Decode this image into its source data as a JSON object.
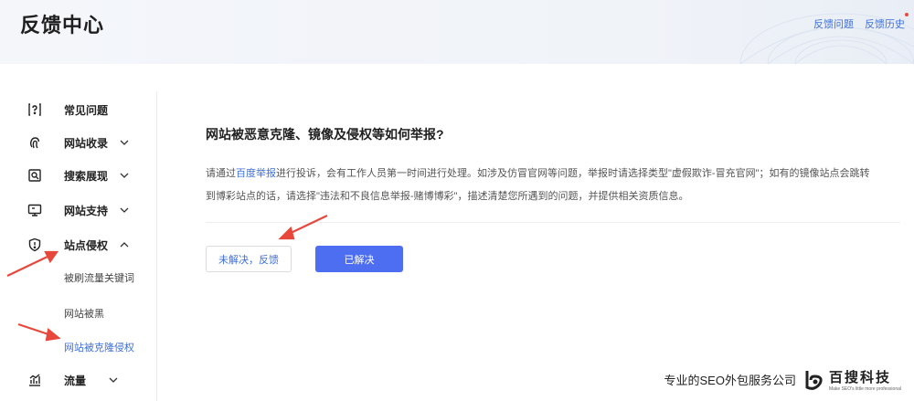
{
  "header": {
    "title": "反馈中心",
    "links": [
      "反馈问题",
      "反馈历史"
    ]
  },
  "sidebar": {
    "items": [
      {
        "label": "常见问题",
        "icon": "question-doc-icon"
      },
      {
        "label": "网站收录",
        "icon": "fingerprint-icon",
        "expanded": false
      },
      {
        "label": "搜索展现",
        "icon": "search-doc-icon",
        "expanded": false
      },
      {
        "label": "网站支持",
        "icon": "monitor-icon",
        "expanded": false
      },
      {
        "label": "站点侵权",
        "icon": "shield-alert-icon",
        "expanded": true
      },
      {
        "label": "流量",
        "icon": "bar-chart-icon",
        "expanded": false
      }
    ],
    "sub_items": [
      "被刷流量关键词",
      "网站被黑",
      "网站被克隆侵权"
    ],
    "active_sub_item": "网站被克隆侵权"
  },
  "main": {
    "question_title": "网站被恶意克隆、镜像及侵权等如何举报?",
    "body_prefix": "请通过",
    "body_link": "百度举报",
    "body_line1_rest": "进行投诉，会有工作人员第一时间进行处理。如涉及仿冒官网等问题，举报时请选择类型\"虚假欺诈-冒充官网\"；如有的镜像站点会跳转",
    "body_line2": "到博彩站点的话，请选择\"违法和不良信息举报-赌博博彩\"，描述清楚您所遇到的问题，并提供相关资质信息。",
    "btn_unresolved": "未解决，反馈",
    "btn_resolved": "已解决"
  },
  "watermark": {
    "text": "专业的SEO外包服务公司",
    "brand": "百搜科技",
    "tagline": "Make SEO's little more professional"
  },
  "colors": {
    "accent": "#3f6fd8",
    "primary_button": "#4e6ef2",
    "arrow": "#e8483b"
  }
}
